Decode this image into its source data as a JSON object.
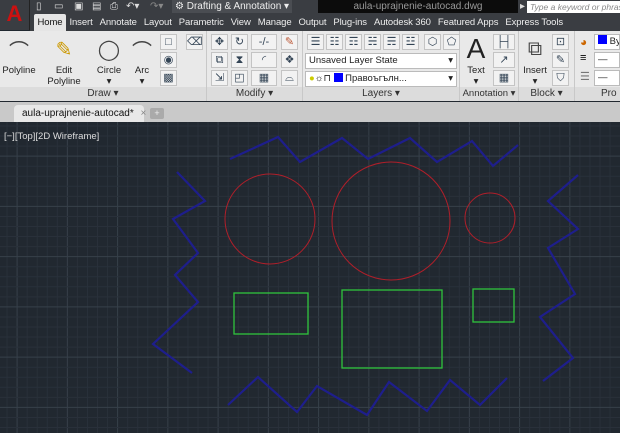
{
  "app": {
    "logo_letter": "A",
    "workspace": "Drafting & Annotation",
    "document_title": "aula-uprajnenie-autocad.dwg",
    "search_placeholder": "Type a keyword or phrase"
  },
  "quick_access": [
    "new-icon",
    "open-icon",
    "save-icon",
    "save-as-icon",
    "print-icon",
    "undo-icon",
    "redo-icon"
  ],
  "ribbon_tabs": [
    "Home",
    "Insert",
    "Annotate",
    "Layout",
    "Parametric",
    "View",
    "Manage",
    "Output",
    "Plug-ins",
    "Autodesk 360",
    "Featured Apps",
    "Express Tools"
  ],
  "active_tab": "Home",
  "panels": {
    "draw": {
      "label": "Draw ▾",
      "polyline": "Polyline",
      "edit_polyline": "Edit Polyline",
      "circle": "Circle",
      "arc": "Arc"
    },
    "modify": {
      "label": "Modify ▾"
    },
    "layers": {
      "label": "Layers ▾",
      "layer_state": "Unsaved Layer State",
      "current_layer": "Правоъгълн...",
      "layer_color": "#0000ff"
    },
    "annotation": {
      "label": "Annotation ▾",
      "text": "Text"
    },
    "block": {
      "label": "Block ▾",
      "insert": "Insert"
    },
    "properties": {
      "label": "Pro",
      "color_value": "By",
      "color": "#0000ff"
    }
  },
  "document_tab": {
    "name": "aula-uprajnenie-autocad*",
    "close": "×"
  },
  "viewport_label": "[−][Top][2D Wireframe]",
  "drawing": {
    "background": "#212830",
    "colors": {
      "outline": "#1e1e8c",
      "circles": "#b01f2a",
      "rectangles": "#2fc43c"
    }
  }
}
